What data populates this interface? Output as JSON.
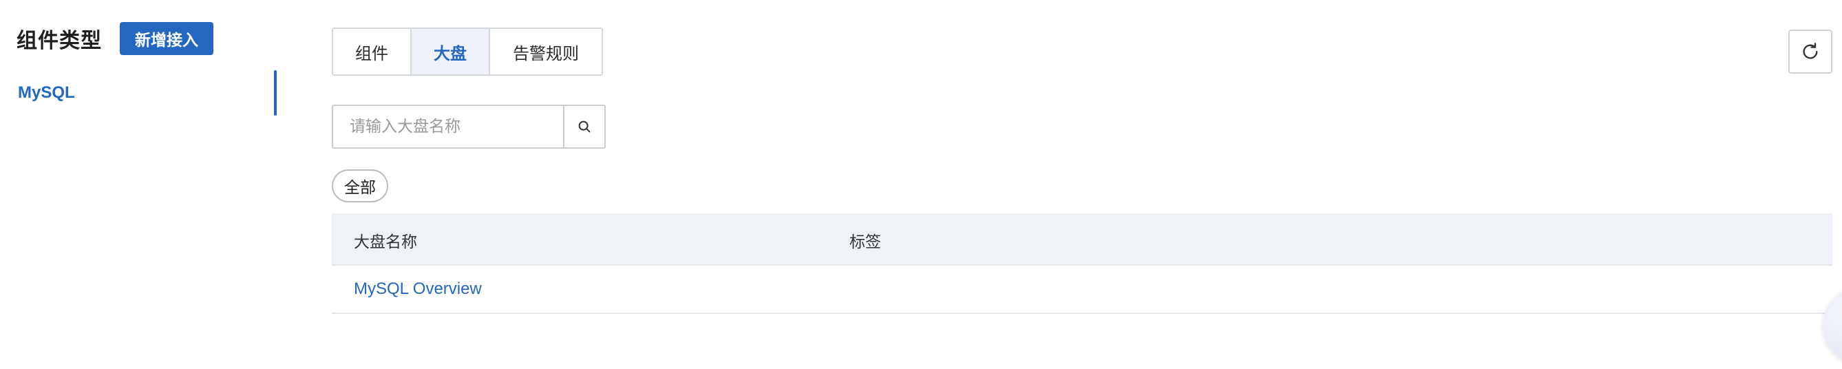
{
  "sidebar": {
    "title": "组件类型",
    "add_button_label": "新增接入",
    "items": [
      {
        "label": "MySQL",
        "active": true
      }
    ]
  },
  "tabs": [
    {
      "label": "组件",
      "active": false
    },
    {
      "label": "大盘",
      "active": true
    },
    {
      "label": "告警规则",
      "active": false
    }
  ],
  "toolbar": {
    "refresh_icon": "refresh-icon"
  },
  "search": {
    "placeholder": "请输入大盘名称",
    "value": "",
    "icon": "search-icon"
  },
  "filters": {
    "chips": [
      {
        "label": "全部"
      }
    ]
  },
  "table": {
    "columns": [
      "大盘名称",
      "标签"
    ],
    "rows": [
      {
        "name": "MySQL Overview",
        "tags": ""
      }
    ]
  },
  "colors": {
    "accent": "#2467c2",
    "table_header_bg": "#eff2f6",
    "active_tab_bg": "#eef2f8"
  }
}
